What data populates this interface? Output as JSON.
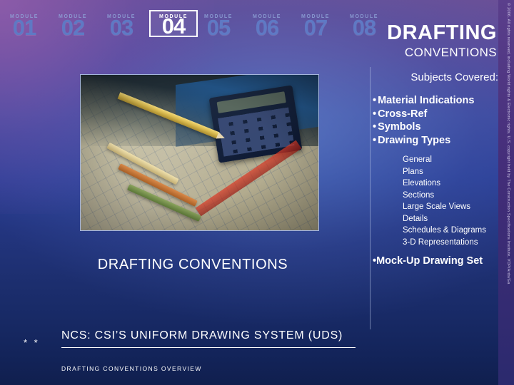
{
  "module_bar": {
    "label_text": "MODULE",
    "items": [
      {
        "label": "MODULE",
        "number": "01",
        "active": false
      },
      {
        "label": "MODULE",
        "number": "02",
        "active": false
      },
      {
        "label": "MODULE",
        "number": "03",
        "active": false
      },
      {
        "label": "MODULE",
        "number": "04",
        "active": true
      },
      {
        "label": "MODULE",
        "number": "05",
        "active": false
      },
      {
        "label": "MODULE",
        "number": "06",
        "active": false
      },
      {
        "label": "MODULE",
        "number": "07",
        "active": false
      },
      {
        "label": "MODULE",
        "number": "08",
        "active": false
      }
    ]
  },
  "title": {
    "main": "DRAFTING",
    "sub": "CONVENTIONS"
  },
  "left_caption": "DRAFTING CONVENTIONS",
  "right_column": {
    "heading": "Subjects Covered:",
    "bullets": [
      {
        "marker": "•",
        "text": "Material Indications"
      },
      {
        "marker": "•",
        "text": "Cross-Ref"
      },
      {
        "marker": "•",
        "text": "Symbols"
      },
      {
        "marker": "•",
        "text": "Drawing Types"
      }
    ],
    "sub_items": [
      "General",
      "Plans",
      "Elevations",
      "Sections",
      "Large Scale Views",
      "Details",
      "Schedules & Diagrams",
      "3-D Representations"
    ],
    "last_bullet": {
      "marker": "•",
      "text": "Mock-Up Drawing Set"
    }
  },
  "footer": {
    "marks": "* *",
    "title": "NCS: CSI’S UNIFORM DRAWING SYSTEM (UDS)",
    "subtitle": "DRAFTING CONVENTIONS OVERVIEW"
  },
  "copyright": "© 2006. All rights reserved, including World rights & Electronic rights. U.S. copyright held by The Construction Specifications Institute, VDP/Ards/Ga",
  "colors": {
    "background_top": "#6b4f96",
    "background_bottom": "#101f4e",
    "accent_white": "#ffffff",
    "module_inactive": "#5f79c4",
    "strip": "#4a2f7a"
  }
}
